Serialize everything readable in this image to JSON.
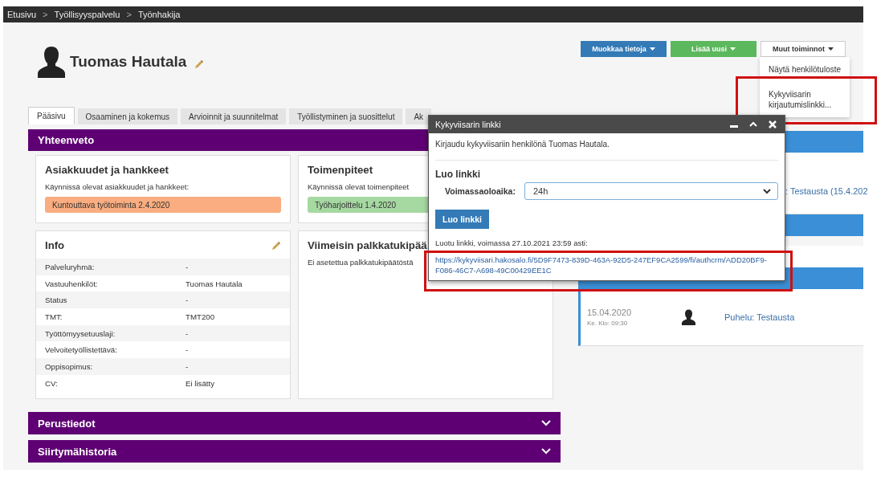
{
  "breadcrumb": {
    "separator": ">",
    "items": [
      {
        "label": "Etusivu"
      },
      {
        "label": "Työllisyyspalvelu"
      },
      {
        "label": "Työnhakija"
      }
    ]
  },
  "person": {
    "name": "Tuomas Hautala"
  },
  "actions": [
    {
      "label": "Muokkaa tietoja",
      "kind": "primary"
    },
    {
      "label": "Lisää uusi",
      "kind": "success"
    },
    {
      "label": "Muut toiminnot",
      "kind": "default"
    }
  ],
  "menu": {
    "items": [
      {
        "label": "Näytä henkilötuloste",
        "highlighted": false
      },
      {
        "label": "Kykyviisarin kirjautumislinkki...",
        "highlighted": true
      }
    ]
  },
  "tabs": [
    {
      "label": "Pääsivu",
      "selected": true
    },
    {
      "label": "Osaaminen ja kokemus",
      "selected": false
    },
    {
      "label": "Arvioinnit ja suunnitelmat",
      "selected": false
    },
    {
      "label": "Työllistyminen ja suosittelut",
      "selected": false
    },
    {
      "label": "Ak",
      "selected": false
    }
  ],
  "summary": {
    "title": "Yhteenveto",
    "cards": [
      {
        "kind": "tag",
        "title": "Asiakkuudet ja hankkeet",
        "subtitle": "Käynnissä olevat asiakkuudet ja hankkeet:",
        "tag": "Kuntouttava työtoiminta 2.4.2020",
        "color": "#f9ad80"
      },
      {
        "kind": "tag",
        "title": "Toimenpiteet",
        "subtitle": "Käynnissä olevat toimenpiteet",
        "tag": "Työharjoittelu 1.4.2020",
        "color": "#a6d8a1"
      },
      {
        "kind": "info",
        "title": "Info",
        "editable": true,
        "rows": [
          {
            "label": "Palveluryhmä:",
            "value": "-"
          },
          {
            "label": "Vastuuhenkilöt:",
            "value": "Tuomas Hautala"
          },
          {
            "label": "Status",
            "value": "-"
          },
          {
            "label": "TMT:",
            "value": "TMT200"
          },
          {
            "label": "Työttömyysetuuslaji:",
            "value": "-"
          },
          {
            "label": "Velvoitetyöllistettävä:",
            "value": "-"
          },
          {
            "label": "Oppisopimus:",
            "value": "-"
          },
          {
            "label": "CV:",
            "value": "Ei lisätty"
          }
        ]
      },
      {
        "kind": "text",
        "title": "Viimeisin palkkatukipää",
        "text": "Ei asetettua palkkatukipäätöstä"
      }
    ]
  },
  "collapsibles": [
    {
      "title": "Perustiedot",
      "expanded": false
    },
    {
      "title": "Siirtymähistoria",
      "expanded": false
    }
  ],
  "side": {
    "snippet": ": Testausta (15.4.202",
    "events": [
      {
        "date": "15.04.2020",
        "time": "Ke. Klo: 09:30",
        "title": "Puhelu: Testausta"
      }
    ]
  },
  "dialog": {
    "title": "Kykyviisarin linkki",
    "intro": "Kirjaudu kykyviisariin henkilönä Tuomas Hautala.",
    "heading": "Luo linkki",
    "field": {
      "label": "Voimassaoloaika:",
      "value": "24h"
    },
    "button": "Luo linkki",
    "result": "Luotu linkki, voimassa 27.10.2021 23:59 asti:",
    "link": "https://kykyviisari.hakosalo.fi/5D9F7473-839D-463A-92D5-247EF9CA2599/fi/authcrm/ADD20BF9-F086-46C7-A698-49C00429EE1C",
    "link_highlighted": true
  }
}
